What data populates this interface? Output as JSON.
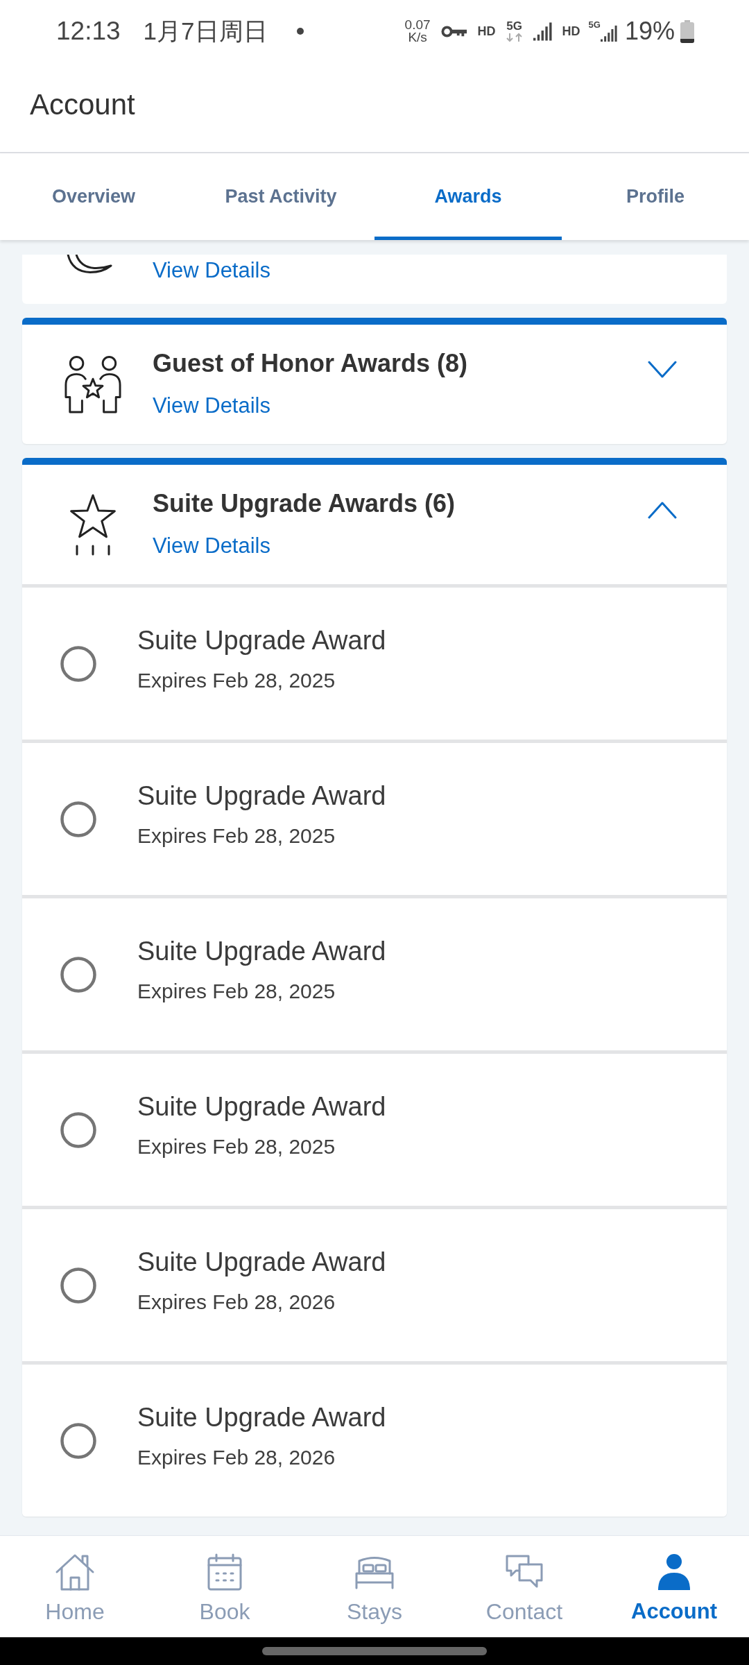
{
  "status_bar": {
    "time": "12:13",
    "date": "1月7日周日",
    "net_speed": "0.07",
    "net_speed_unit": "K/s",
    "sims": [
      {
        "kind": "arrows",
        "hd": "HD",
        "network": "5G"
      },
      {
        "kind": "corner",
        "hd": "HD",
        "network": "5G"
      }
    ],
    "battery": "19%"
  },
  "header": {
    "title": "Account"
  },
  "tabs": [
    {
      "label": "Overview",
      "selected": false
    },
    {
      "label": "Past Activity",
      "selected": false
    },
    {
      "label": "Awards",
      "selected": true
    },
    {
      "label": "Profile",
      "selected": false
    }
  ],
  "award_groups": [
    {
      "kind": "clipped",
      "link": "View Details"
    },
    {
      "kind": "full",
      "title": "Guest of Honor Awards (8)",
      "link": "View Details",
      "expanded": false
    },
    {
      "kind": "full",
      "title": "Suite Upgrade Awards (6)",
      "link": "View Details",
      "expanded": true,
      "items": [
        {
          "name": "Suite Upgrade Award",
          "expiry": "Expires Feb 28, 2025",
          "selected": false
        },
        {
          "name": "Suite Upgrade Award",
          "expiry": "Expires Feb 28, 2025",
          "selected": false
        },
        {
          "name": "Suite Upgrade Award",
          "expiry": "Expires Feb 28, 2025",
          "selected": false
        },
        {
          "name": "Suite Upgrade Award",
          "expiry": "Expires Feb 28, 2025",
          "selected": false
        },
        {
          "name": "Suite Upgrade Award",
          "expiry": "Expires Feb 28, 2026",
          "selected": false
        },
        {
          "name": "Suite Upgrade Award",
          "expiry": "Expires Feb 28, 2026",
          "selected": false
        }
      ]
    }
  ],
  "bottom_nav": [
    {
      "label": "Home",
      "selected": false
    },
    {
      "label": "Book",
      "selected": false
    },
    {
      "label": "Stays",
      "selected": false
    },
    {
      "label": "Contact",
      "selected": false
    },
    {
      "label": "Account",
      "selected": true
    }
  ]
}
